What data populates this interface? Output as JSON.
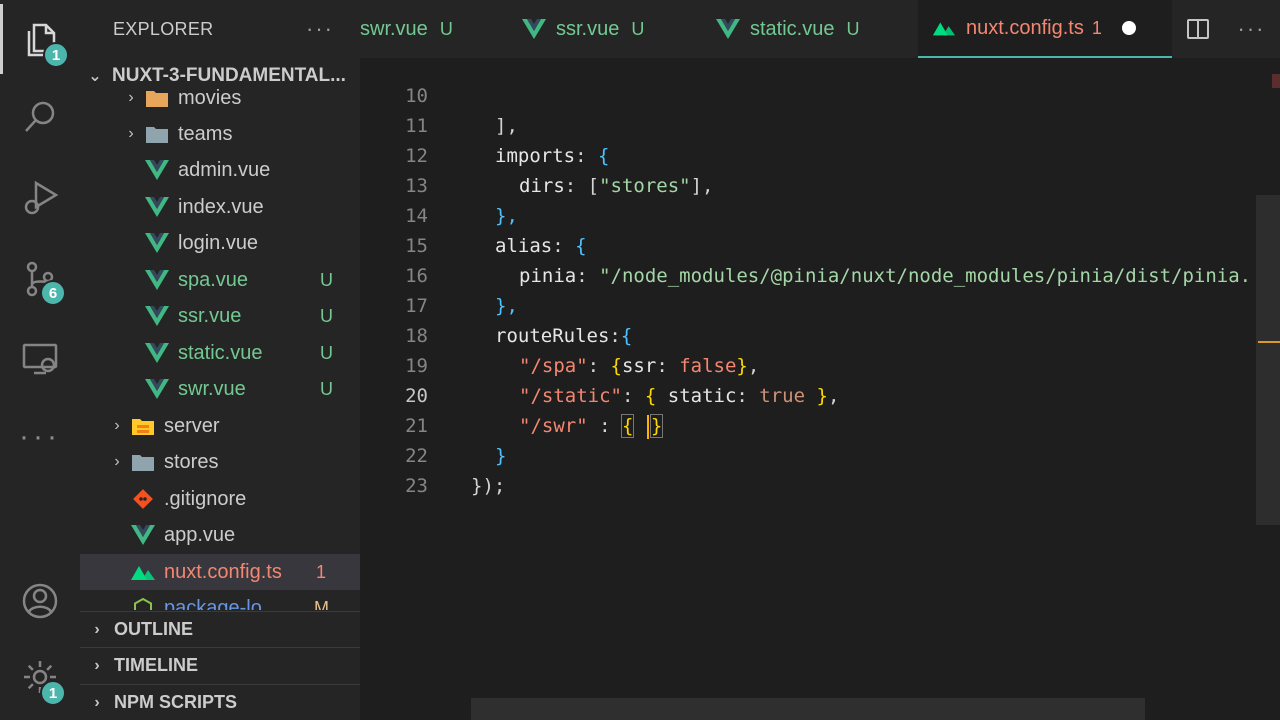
{
  "activity": {
    "explorer_badge": "1",
    "source_control_badge": "6",
    "settings_badge": "1"
  },
  "sidebar": {
    "title": "EXPLORER",
    "more": "···",
    "root": "NUXT-3-FUNDAMENTAL...",
    "items": [
      {
        "name": "movies",
        "type": "folder",
        "status": ""
      },
      {
        "name": "teams",
        "type": "folder",
        "status": ""
      },
      {
        "name": "admin.vue",
        "type": "vue",
        "status": ""
      },
      {
        "name": "index.vue",
        "type": "vue",
        "status": ""
      },
      {
        "name": "login.vue",
        "type": "vue",
        "status": ""
      },
      {
        "name": "spa.vue",
        "type": "vue",
        "status": "U"
      },
      {
        "name": "ssr.vue",
        "type": "vue",
        "status": "U"
      },
      {
        "name": "static.vue",
        "type": "vue",
        "status": "U"
      },
      {
        "name": "swr.vue",
        "type": "vue",
        "status": "U"
      },
      {
        "name": "server",
        "type": "folder-yellow",
        "status": ""
      },
      {
        "name": "stores",
        "type": "folder",
        "status": ""
      },
      {
        "name": ".gitignore",
        "type": "git",
        "status": ""
      },
      {
        "name": "app.vue",
        "type": "vue",
        "status": ""
      },
      {
        "name": "nuxt.config.ts",
        "type": "nuxt",
        "status": "1"
      },
      {
        "name": "package-lo...",
        "type": "json",
        "status": "M"
      }
    ],
    "sections": [
      "OUTLINE",
      "TIMELINE",
      "NPM SCRIPTS"
    ]
  },
  "tabs": [
    {
      "name": "swr.vue",
      "status": "U"
    },
    {
      "name": "ssr.vue",
      "status": "U"
    },
    {
      "name": "static.vue",
      "status": "U"
    },
    {
      "name": "nuxt.config.ts",
      "status": "1"
    }
  ],
  "editor": {
    "line_numbers": [
      "10",
      "11",
      "12",
      "13",
      "14",
      "15",
      "16",
      "17",
      "18",
      "19",
      "20",
      "21",
      "22",
      "23"
    ],
    "current_line": "20",
    "code": {
      "l10": "],",
      "l11_key": "imports",
      "l12_key": "dirs",
      "l12_val": "\"stores\"",
      "l13": "},",
      "l14_key": "alias",
      "l15_key": "pinia",
      "l15_val": "\"/node_modules/@pinia/nuxt/node_modules/pinia/dist/pinia.",
      "l16": "},",
      "l17_key": "routeRules",
      "l18_path": "\"/spa\"",
      "l18_key": "ssr",
      "l18_val": "false",
      "l19_path": "\"/static\"",
      "l19_key": "static",
      "l19_val": "true",
      "l20_path": "\"/swr\"",
      "l21": "}",
      "l22": "});"
    }
  }
}
